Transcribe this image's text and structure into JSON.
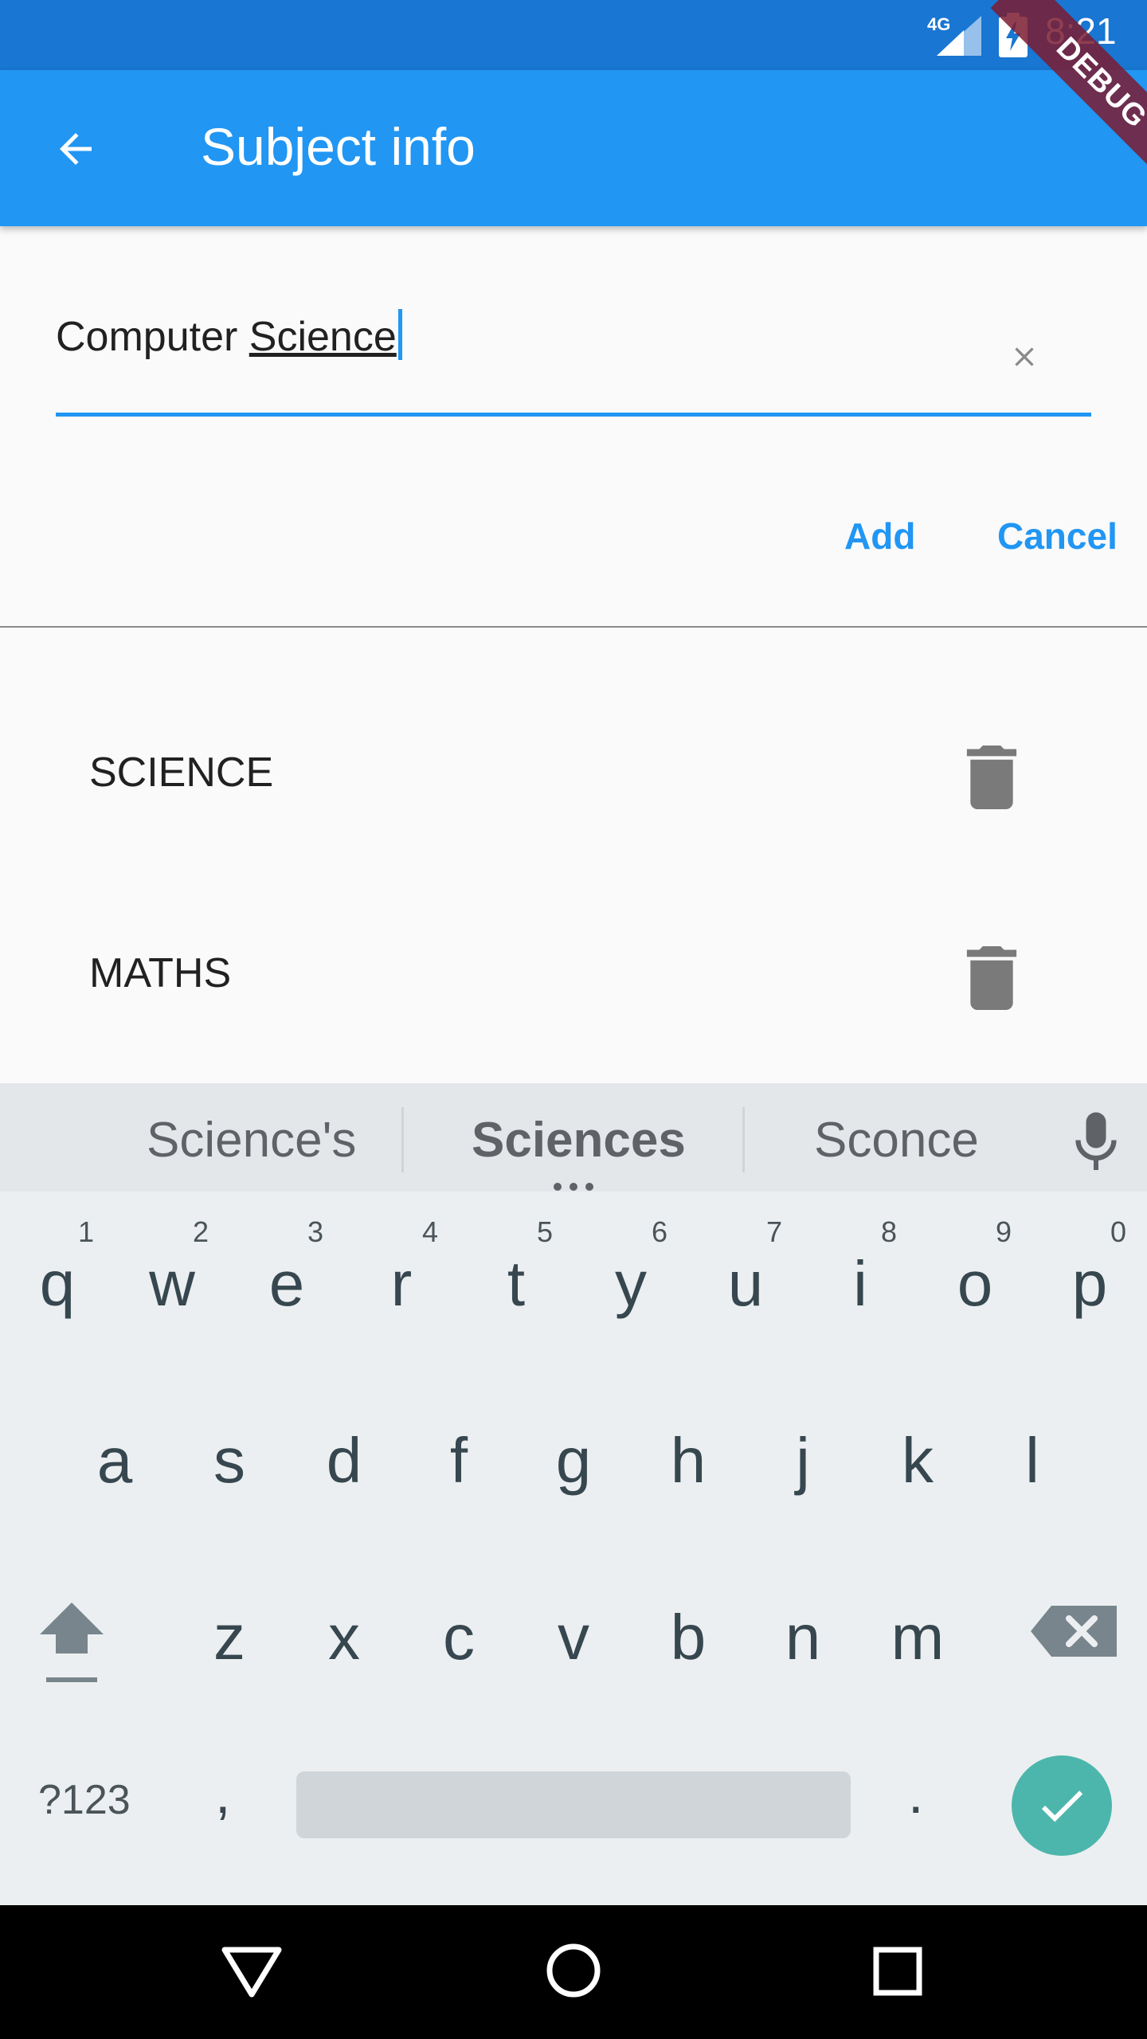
{
  "status_bar": {
    "network": "4G",
    "time": "8:21"
  },
  "app_bar": {
    "title": "Subject info"
  },
  "debug_banner": "DEBUG",
  "subject_field": {
    "value_plain": "Computer ",
    "value_underlined": "Science"
  },
  "actions": {
    "add_label": "Add",
    "cancel_label": "Cancel"
  },
  "subjects": [
    {
      "name": "SCIENCE"
    },
    {
      "name": "MATHS"
    }
  ],
  "keyboard": {
    "suggestions": [
      "Science's",
      "Sciences",
      "Sconce"
    ],
    "row1": [
      {
        "ch": "q",
        "num": "1"
      },
      {
        "ch": "w",
        "num": "2"
      },
      {
        "ch": "e",
        "num": "3"
      },
      {
        "ch": "r",
        "num": "4"
      },
      {
        "ch": "t",
        "num": "5"
      },
      {
        "ch": "y",
        "num": "6"
      },
      {
        "ch": "u",
        "num": "7"
      },
      {
        "ch": "i",
        "num": "8"
      },
      {
        "ch": "o",
        "num": "9"
      },
      {
        "ch": "p",
        "num": "0"
      }
    ],
    "row2": [
      "a",
      "s",
      "d",
      "f",
      "g",
      "h",
      "j",
      "k",
      "l"
    ],
    "row3": [
      "z",
      "x",
      "c",
      "v",
      "b",
      "n",
      "m"
    ],
    "symbols_label": "?123",
    "comma": ",",
    "period": "."
  },
  "colors": {
    "primary": "#2196f3",
    "status_bar": "#1976d2",
    "enter_key": "#4db6ac"
  }
}
